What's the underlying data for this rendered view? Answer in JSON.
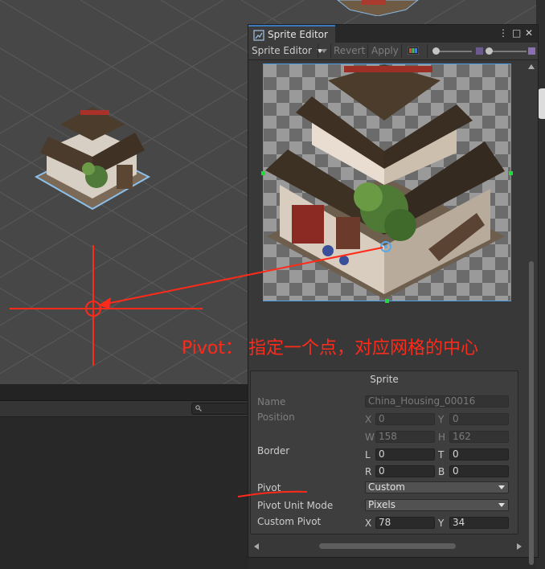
{
  "window": {
    "tab_title": "Sprite Editor",
    "controls": {
      "more": "⋮",
      "maximize": "□",
      "close": "✕"
    }
  },
  "toolbar": {
    "mode_label": "Sprite Editor",
    "revert_label": "Revert",
    "apply_label": "Apply"
  },
  "inspector": {
    "title": "Sprite",
    "name_label": "Name",
    "name_value": "China_Housing_00016",
    "position_label": "Position",
    "position": {
      "x_axis": "X",
      "x": "0",
      "y_axis": "Y",
      "y": "0",
      "w_axis": "W",
      "w": "158",
      "h_axis": "H",
      "h": "162"
    },
    "border_label": "Border",
    "border": {
      "l_axis": "L",
      "l": "0",
      "t_axis": "T",
      "t": "0",
      "r_axis": "R",
      "r": "0",
      "b_axis": "B",
      "b": "0"
    },
    "pivot_label": "Pivot",
    "pivot_value": "Custom",
    "pivot_unit_label": "Pivot Unit Mode",
    "pivot_unit_value": "Pixels",
    "custom_pivot_label": "Custom Pivot",
    "custom_pivot": {
      "x_axis": "X",
      "x": "78",
      "y_axis": "Y",
      "y": "34"
    }
  },
  "annotation": {
    "text": "Pivot： 指定一个点，对应网格的中心",
    "color": "#ff2a1a"
  },
  "colors": {
    "scene_bg": "#474747",
    "panel_bg": "#383838",
    "selection_border": "#4a9ee6",
    "handle": "#1fdc3a",
    "tab_accent": "#3a79bb"
  }
}
